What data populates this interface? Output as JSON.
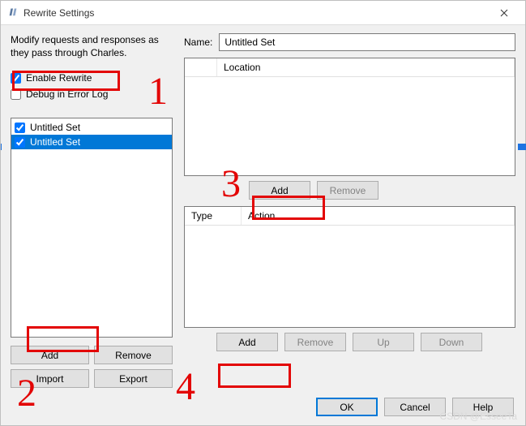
{
  "title": "Rewrite Settings",
  "description": "Modify requests and responses as they pass through Charles.",
  "enable_rewrite": {
    "label": "Enable Rewrite",
    "checked": true
  },
  "debug_log": {
    "label": "Debug in Error Log",
    "checked": false
  },
  "setlist": [
    {
      "label": "Untitled Set",
      "checked": true,
      "selected": false
    },
    {
      "label": "Untitled Set",
      "checked": true,
      "selected": true
    }
  ],
  "left_buttons": {
    "add": "Add",
    "remove": "Remove",
    "import": "Import",
    "export": "Export"
  },
  "name_label": "Name:",
  "name_value": "Untitled Set",
  "loc_table": {
    "col1": "",
    "col2": "Location"
  },
  "loc_buttons": {
    "add": "Add",
    "remove": "Remove"
  },
  "rules_table": {
    "col1": "Type",
    "col2": "Action"
  },
  "rules_buttons": {
    "add": "Add",
    "remove": "Remove",
    "up": "Up",
    "down": "Down"
  },
  "footer": {
    "ok": "OK",
    "cancel": "Cancel",
    "help": "Help"
  },
  "watermark": "CSDN @EsseeTa",
  "annotations": {
    "n1": "1",
    "n2": "2",
    "n3": "3",
    "n4": "4"
  }
}
